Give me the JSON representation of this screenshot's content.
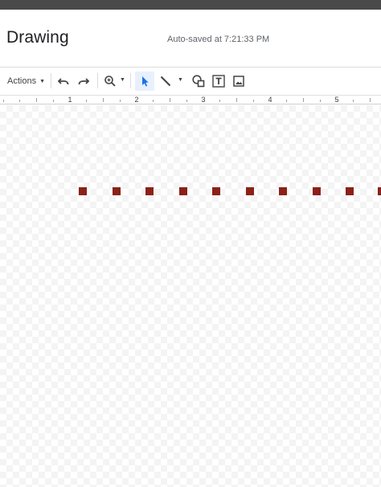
{
  "app": {
    "title": "Drawing",
    "autosave": "Auto-saved at 7:21:33 PM"
  },
  "toolbar": {
    "actions_label": "Actions",
    "icons": [
      "undo-icon",
      "redo-icon",
      "zoom-icon",
      "select-icon",
      "line-icon",
      "shape-icon",
      "text-box-icon",
      "image-icon"
    ]
  },
  "ruler": {
    "labels": [
      "1",
      "2",
      "3",
      "4",
      "5"
    ]
  },
  "canvas": {
    "shape_color": "#8b2118",
    "dot_count": 10
  },
  "colors": {
    "accent": "#1a73e8",
    "selected_bg": "#e8f0fe"
  }
}
